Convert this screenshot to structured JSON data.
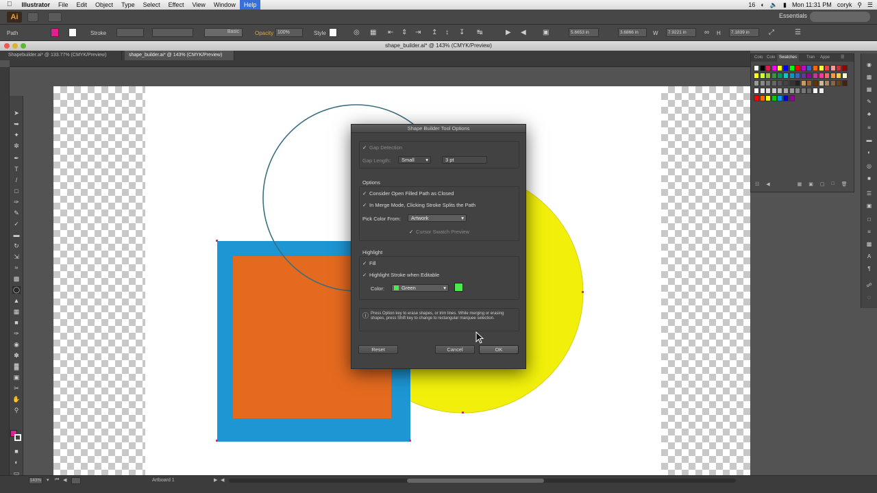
{
  "menubar": {
    "app_name": "Illustrator",
    "items": [
      "File",
      "Edit",
      "Object",
      "Type",
      "Select",
      "Effect",
      "View",
      "Window",
      "Help"
    ],
    "clock": "Mon 11:31 PM",
    "user": "coryk",
    "badge_number": "16"
  },
  "appbar": {
    "logo": "Ai",
    "workspace": "Essentials"
  },
  "control_bar": {
    "selection_label": "Path",
    "fill_color": "#e0208c",
    "stroke_label": "Stroke",
    "brush_label": "Basic",
    "opacity_label": "Opacity",
    "opacity_value": "100%",
    "style_label": "Style",
    "x_value": "5.6653 in",
    "y_value": "3.6866 in",
    "w_label": "W",
    "w_value": "7.9221 in",
    "h_label": "H",
    "h_value": "7.1839 in"
  },
  "window": {
    "title": "shape_builder.ai* @ 143% (CMYK/Preview)"
  },
  "tabs": [
    {
      "label": "Shapebuilder.ai* @ 133.77% (CMYK/Preview)",
      "active": false
    },
    {
      "label": "shape_builder.ai* @ 143% (CMYK/Preview)",
      "active": true
    }
  ],
  "artwork": {
    "blue": "#1d96d3",
    "orange": "#e46a1f",
    "yellow": "#f2f00a",
    "circle_stroke": "#3a6f7e"
  },
  "dialog": {
    "title": "Shape Builder Tool Options",
    "gap_detection_label": "Gap Detection",
    "gap_length_label": "Gap Length:",
    "gap_length_value": "Small",
    "gap_length_measure": "3 pt",
    "options_heading": "Options",
    "consider_open_label": "Consider Open Filled Path as Closed",
    "merge_mode_label": "In Merge Mode, Clicking Stroke Splits the Path",
    "pick_color_label": "Pick Color From:",
    "pick_color_value": "Artwork",
    "cursor_swatch_label": "Cursor Swatch Preview",
    "highlight_heading": "Highlight",
    "fill_label": "Fill",
    "highlight_stroke_label": "Highlight Stroke when Editable",
    "color_label": "Color:",
    "color_value": "Green",
    "highlight_color": "#4ee84e",
    "info_text": "Press Option key to erase shapes, or trim lines. While merging or erasing shapes, press Shift key to change to rectangular marquee selection.",
    "reset_label": "Reset",
    "cancel_label": "Cancel",
    "ok_label": "OK"
  },
  "panels": {
    "tabs": [
      "Colo",
      "Colo",
      "Swatches",
      "Tran",
      "Appe"
    ],
    "active_tab": "Swatches"
  },
  "statusbar": {
    "zoom": "143%",
    "artboard": "Artboard 1"
  }
}
